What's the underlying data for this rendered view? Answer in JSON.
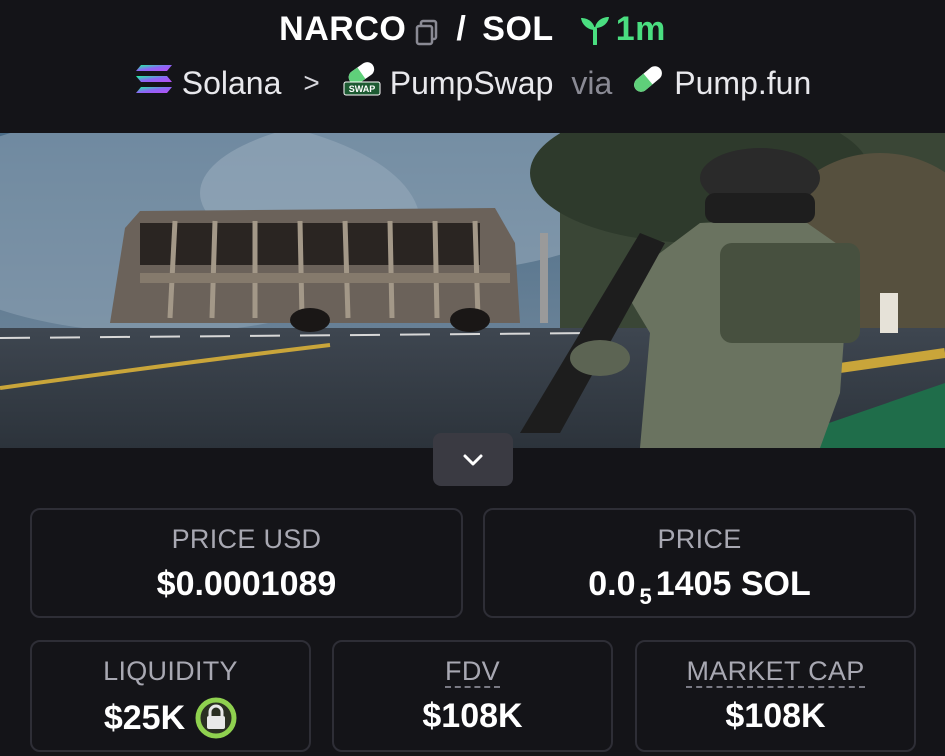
{
  "header": {
    "base_symbol": "NARCO",
    "slash": "/",
    "quote_symbol": "SOL",
    "age": "1m",
    "chain": "Solana",
    "chevron": ">",
    "dex": "PumpSwap",
    "via": "via",
    "launchpad": "Pump.fun",
    "dex_badge_text": "SWAP"
  },
  "stats": {
    "price_usd": {
      "label": "PRICE USD",
      "value": "$0.0001089"
    },
    "price": {
      "label": "PRICE",
      "prefix": "0.0",
      "zeros": "5",
      "suffix": "1405 SOL"
    },
    "liquidity": {
      "label": "LIQUIDITY",
      "value": "$25K"
    },
    "fdv": {
      "label": "FDV",
      "value": "$108K"
    },
    "market_cap": {
      "label": "MARKET CAP",
      "value": "$108K"
    }
  },
  "colors": {
    "background": "#141418",
    "age_green": "#4ade80",
    "card_border": "#2e2e36",
    "label_gray": "#a8a8b2",
    "lock_green": "#8fd14f"
  },
  "icons": {
    "copy": "copy-icon",
    "sprout": "sprout-icon",
    "solana": "solana-logo-icon",
    "pill": "pill-icon",
    "expand": "chevron-down-icon",
    "lock": "lock-icon"
  }
}
